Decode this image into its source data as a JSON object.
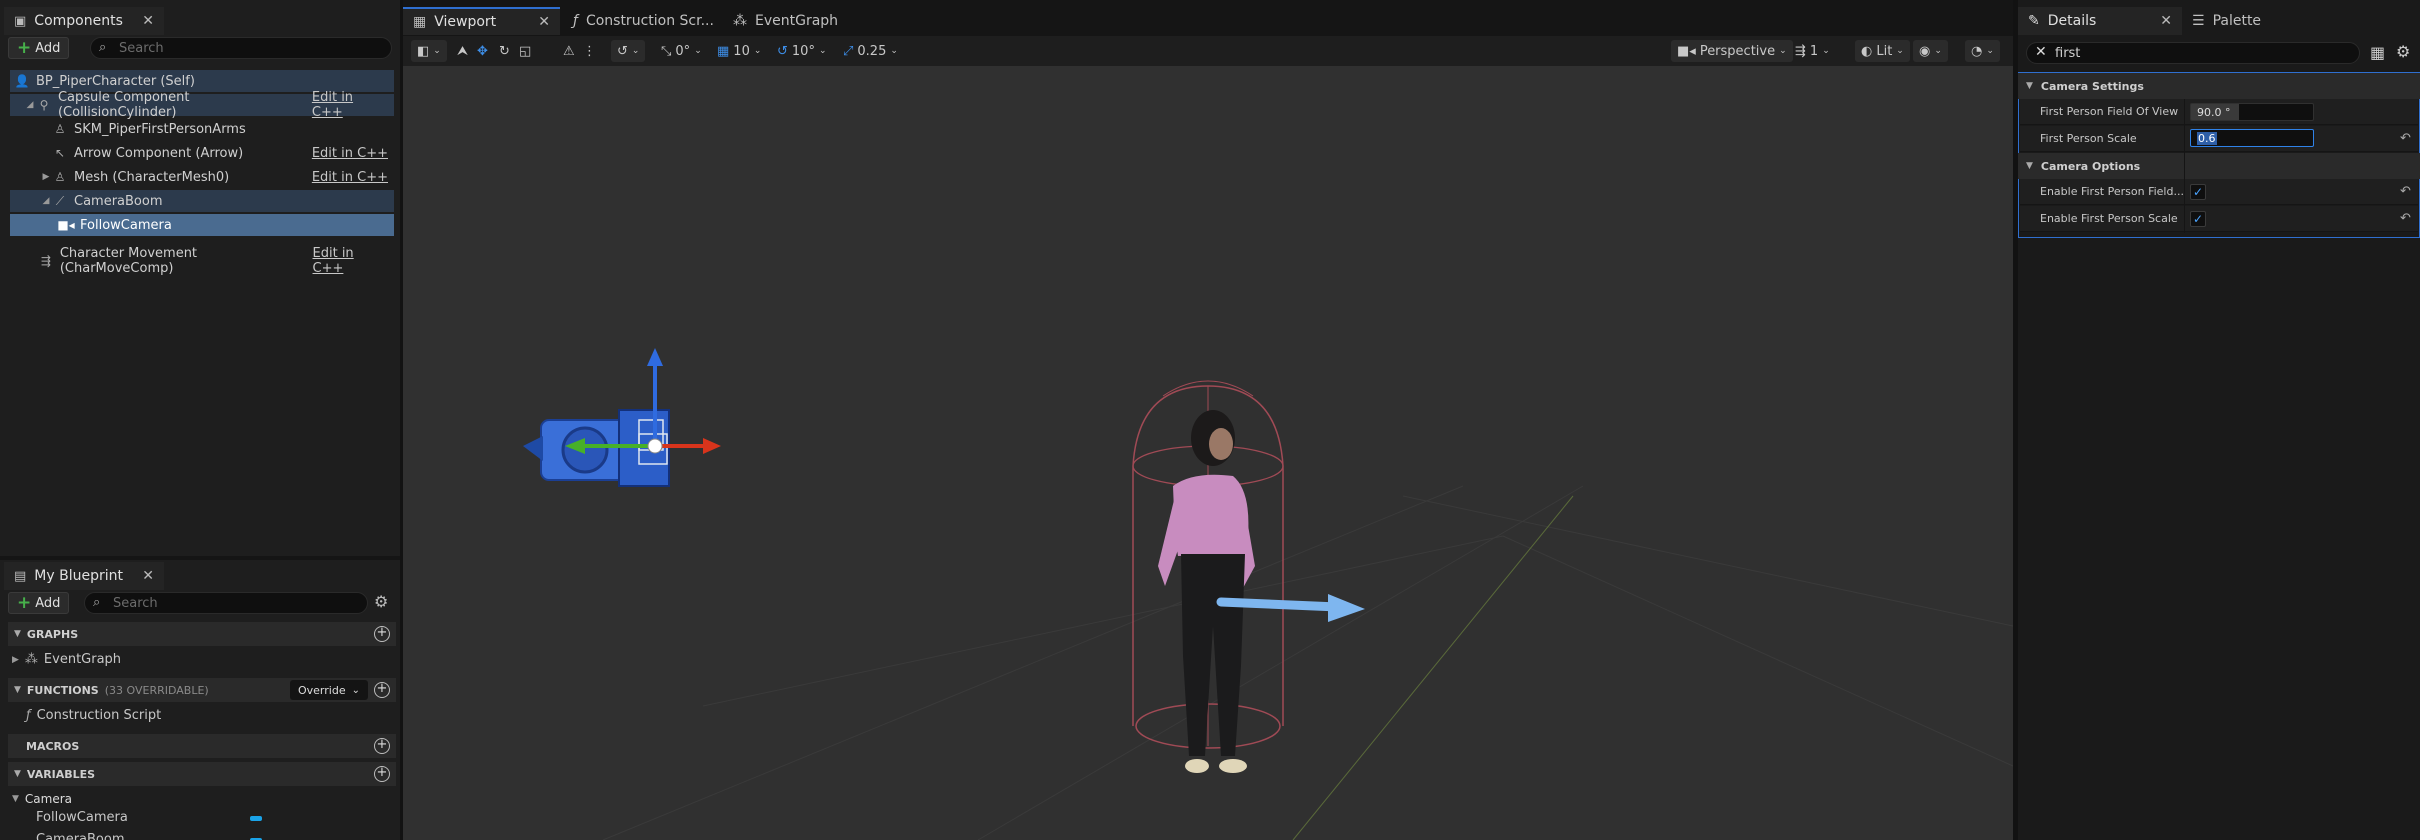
{
  "components_panel": {
    "tab_label": "Components",
    "add_label": "Add",
    "search_placeholder": "Search",
    "tree": [
      {
        "label": "BP_PiperCharacter (Self)"
      },
      {
        "label": "Capsule Component (CollisionCylinder)",
        "edit": "Edit in C++"
      },
      {
        "label": "SKM_PiperFirstPersonArms"
      },
      {
        "label": "Arrow Component (Arrow)",
        "edit": "Edit in C++"
      },
      {
        "label": "Mesh (CharacterMesh0)",
        "edit": "Edit in C++"
      },
      {
        "label": "CameraBoom"
      },
      {
        "label": "FollowCamera"
      },
      {
        "label": "Character Movement (CharMoveComp)",
        "edit": "Edit in C++"
      }
    ]
  },
  "my_blueprint": {
    "tab_label": "My Blueprint",
    "add_label": "Add",
    "search_placeholder": "Search",
    "graphs_label": "GRAPHS",
    "event_graph": "EventGraph",
    "functions_label": "FUNCTIONS",
    "functions_count": "(33 OVERRIDABLE)",
    "override_label": "Override",
    "construction_script": "Construction Script",
    "macros_label": "MACROS",
    "variables_label": "VARIABLES",
    "category": "Camera",
    "variables": [
      "FollowCamera",
      "CameraBoom"
    ]
  },
  "editor_tabs": {
    "viewport": "Viewport",
    "construction": "Construction Scr...",
    "event_graph": "EventGraph"
  },
  "viewport_toolbar": {
    "rotation_snap": "0°",
    "grid_snap": "10",
    "angle_snap": "10°",
    "scale_snap": "0.25",
    "view_mode": "Perspective",
    "camera_speed": "1",
    "lighting": "Lit"
  },
  "details_panel": {
    "tab_label": "Details",
    "palette_label": "Palette",
    "search_value": "first",
    "camera_settings_label": "Camera Settings",
    "fov_label": "First Person Field Of View",
    "fov_value": "90.0 °",
    "scale_label": "First Person Scale",
    "scale_value": "0.6",
    "camera_options_label": "Camera Options",
    "enable_fov_label": "Enable First Person Field...",
    "enable_scale_label": "Enable First Person Scale",
    "enable_fov": true,
    "enable_scale": true
  },
  "colors": {
    "accent": "#2f6fd0",
    "selection": "#4a6b90",
    "variable_pin": "#1aa3e8"
  }
}
